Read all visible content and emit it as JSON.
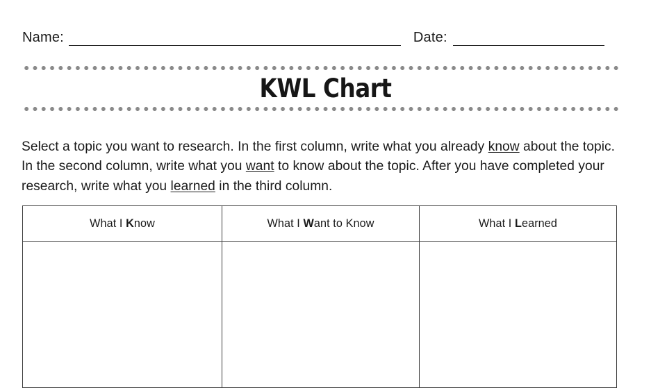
{
  "header": {
    "name_label": "Name:",
    "date_label": "Date:",
    "name_value": "",
    "date_value": ""
  },
  "title": "KWL Chart",
  "instructions": {
    "segments": [
      {
        "text": "Select a topic you want to research. In the first column, write what you already ",
        "underline": false
      },
      {
        "text": "know",
        "underline": true
      },
      {
        "text": " about the topic. In the second column, write what you ",
        "underline": false
      },
      {
        "text": "want",
        "underline": true
      },
      {
        "text": " to know about the topic. After you have completed your research, write what you ",
        "underline": false
      },
      {
        "text": "learned",
        "underline": true
      },
      {
        "text": " in the third column.",
        "underline": false
      }
    ],
    "plain_text": "Select a topic you want to research. In the first column, write what you already know about the topic. In the second column, write what you want to know about the topic. After you have completed your research, write what you learned in the third column."
  },
  "table": {
    "columns": [
      {
        "prefix": "What I ",
        "emphasis": "K",
        "suffix": "now",
        "full": "What I Know"
      },
      {
        "prefix": "What I ",
        "emphasis": "W",
        "suffix": "ant to Know",
        "full": "What I Want to Know"
      },
      {
        "prefix": "What I ",
        "emphasis": "L",
        "suffix": "earned",
        "full": "What I Learned"
      }
    ],
    "rows": [
      {
        "know": "",
        "want": "",
        "learned": ""
      }
    ]
  },
  "style": {
    "dot_color": "#8a8a8a",
    "rule_color": "#1a1a1a",
    "table_border_color": "#3c3c3c",
    "text_color": "#1a1a1a"
  }
}
